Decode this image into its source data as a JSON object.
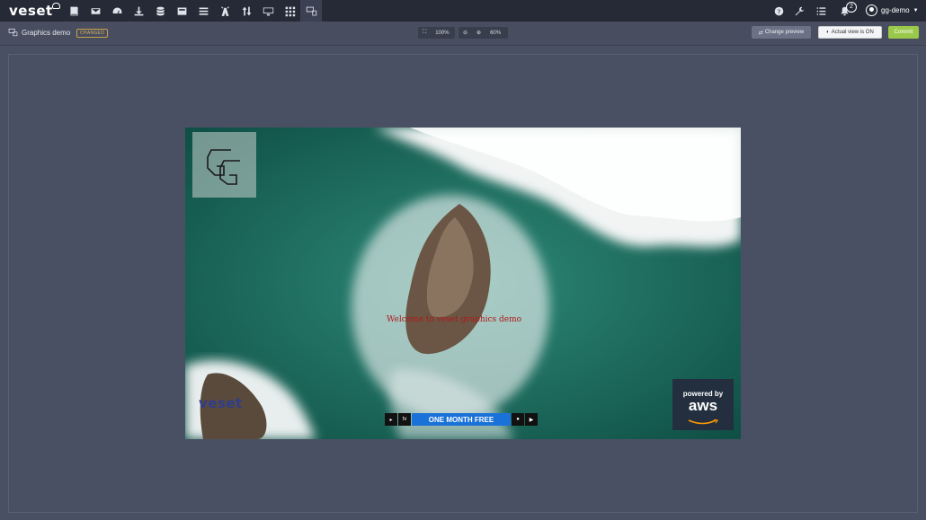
{
  "app": {
    "name": "veset"
  },
  "nav": {
    "icons": [
      "book-icon",
      "mail-icon",
      "dashboard-icon",
      "download-icon",
      "database-icon",
      "tray-icon",
      "list-icon",
      "antenna-icon",
      "sort-icon",
      "monitor-icon",
      "grid-icon",
      "graphics-preview-icon"
    ],
    "active": "graphics-preview-icon"
  },
  "topright": {
    "notifications_count": "2",
    "username": "gg-demo"
  },
  "page": {
    "title": "Graphics demo",
    "status_badge": "CHANGED"
  },
  "zoom": {
    "fit_label": "100%",
    "level": "60%"
  },
  "buttons": {
    "change_preview": "Change preview",
    "actual_view": "Actual view is ON",
    "commit": "Commit"
  },
  "preview": {
    "welcome_text": "Welcome to veset graphics demo",
    "corner_logo": "veset",
    "promo_text": "ONE MONTH FREE",
    "aws_powered": "powered by",
    "aws_brand": "aws"
  },
  "colors": {
    "topbar": "#262a36",
    "workspace": "#4a5063",
    "commit": "#9ac84a",
    "badge": "#c8a24a",
    "promo": "#1a72d8"
  }
}
